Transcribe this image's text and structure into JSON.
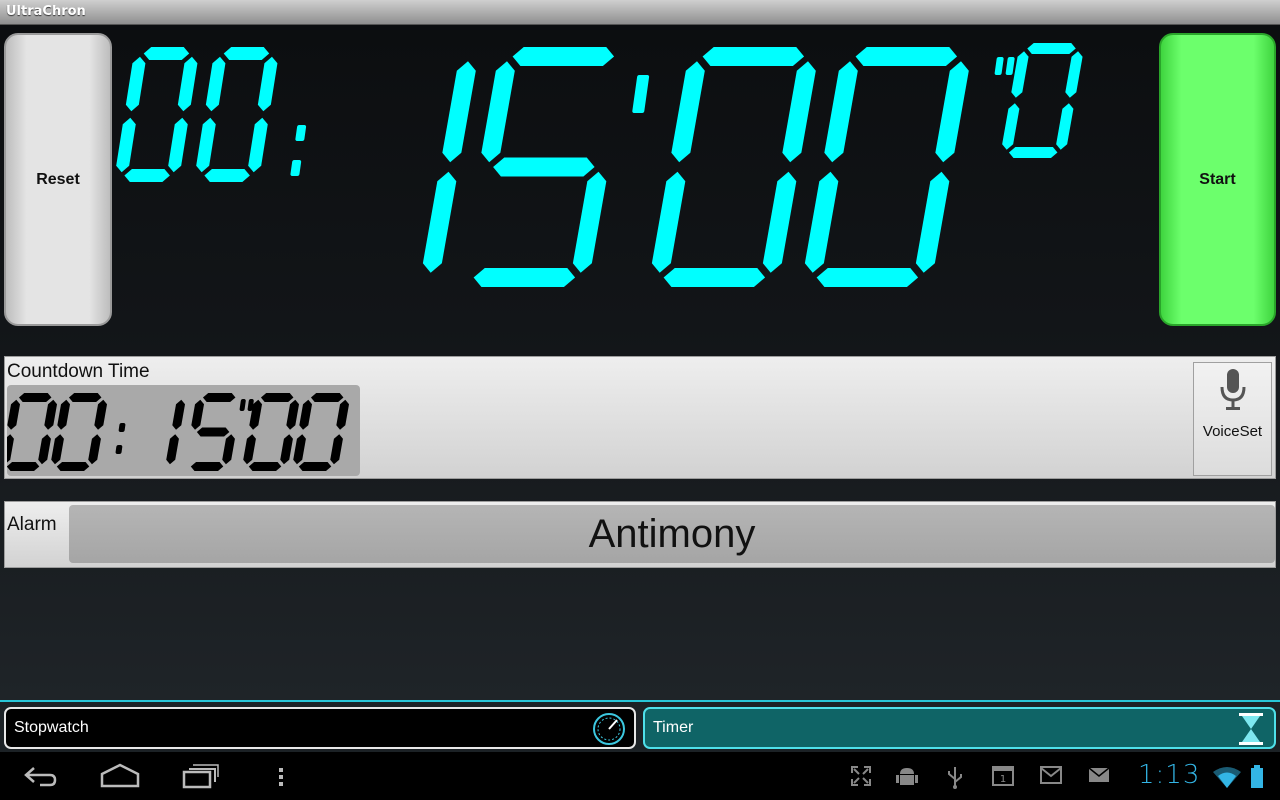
{
  "app": {
    "title": "UltraChron"
  },
  "controls": {
    "reset_label": "Reset",
    "start_label": "Start"
  },
  "display": {
    "hours": "00",
    "minutes": "15",
    "seconds": "00",
    "tenths": "0",
    "color": "#00ffff"
  },
  "countdown": {
    "label": "Countdown Time",
    "value": "00:15\"00"
  },
  "voice": {
    "label": "VoiceSet",
    "icon": "microphone-icon"
  },
  "alarm": {
    "label": "Alarm",
    "value": "Antimony"
  },
  "tabs": [
    {
      "label": "Stopwatch",
      "icon": "stopwatch-icon",
      "active": false
    },
    {
      "label": "Timer",
      "icon": "hourglass-icon",
      "active": true
    }
  ],
  "statusbar": {
    "time": "1:13",
    "icons": [
      "fullscreen-icon",
      "android-debug-icon",
      "usb-icon",
      "calendar-icon",
      "gmail-icon",
      "email-icon",
      "wifi-icon",
      "battery-icon"
    ],
    "accent": "#33b5e5"
  },
  "navbar": {
    "icons": [
      "back-icon",
      "home-icon",
      "recent-apps-icon",
      "menu-icon"
    ]
  }
}
